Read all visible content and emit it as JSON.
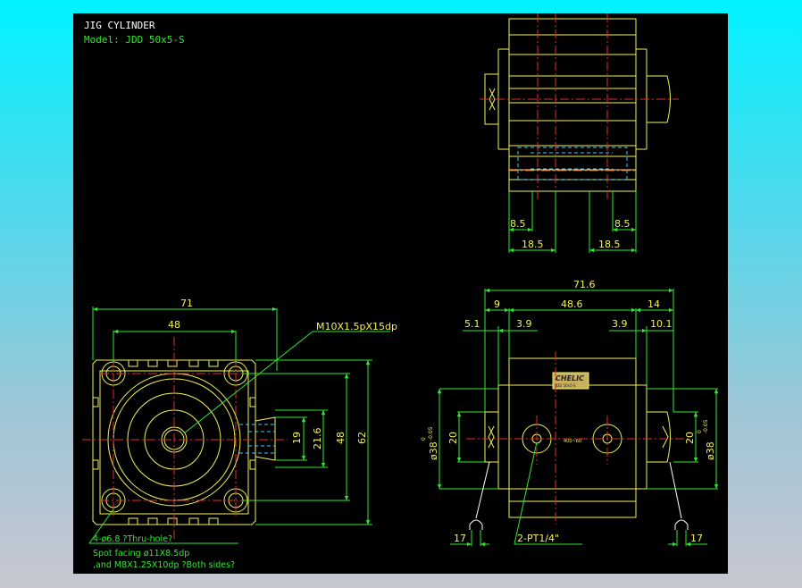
{
  "title": "JIG CYLINDER",
  "model": "Model: JDD 50x5-S",
  "colors": {
    "background": "#000000",
    "outline": "#f2f25a",
    "dimension": "#30e830",
    "centerline": "#e03030",
    "hidden": "#40c8ff",
    "title": "#ffffff"
  },
  "front_view": {
    "dim_width_outer": "71",
    "dim_width_inner": "48",
    "dim_height_outer": "62",
    "dim_height_inner": "48",
    "dim_port_21_6": "21.6",
    "dim_port_19": "19",
    "thread_callout": "M10X1.5pX15dp",
    "hole_note_1": "4-ø6.8 ?Thru-hole?",
    "hole_note_2": "Spot facing ø11X8.5dp",
    "hole_note_3": ",and M8X1.25X10dp ?Both sides?"
  },
  "top_view": {
    "dim_left_8_5": "8.5",
    "dim_right_8_5": "8.5",
    "dim_left_18_5": "18.5",
    "dim_right_18_5": "18.5"
  },
  "side_view": {
    "dim_total": "71.6",
    "dim_9": "9",
    "dim_48_6": "48.6",
    "dim_14": "14",
    "dim_5_1": "5.1",
    "dim_3_9_left": "3.9",
    "dim_3_9_right": "3.9",
    "dim_10_1": "10.1",
    "dim_20_left": "20",
    "dim_20_right": "20",
    "dim_dia_left": "ø38",
    "dim_dia_right": "ø38",
    "tol_upper": "0",
    "tol_lower": "-0.05",
    "dim_17_left": "17",
    "dim_17_right": "17",
    "port_note": "2-PT1/4\"",
    "label_brand": "CHELIC",
    "label_tag": "JDD 50x5-S",
    "stroke_mark": "400~60"
  }
}
